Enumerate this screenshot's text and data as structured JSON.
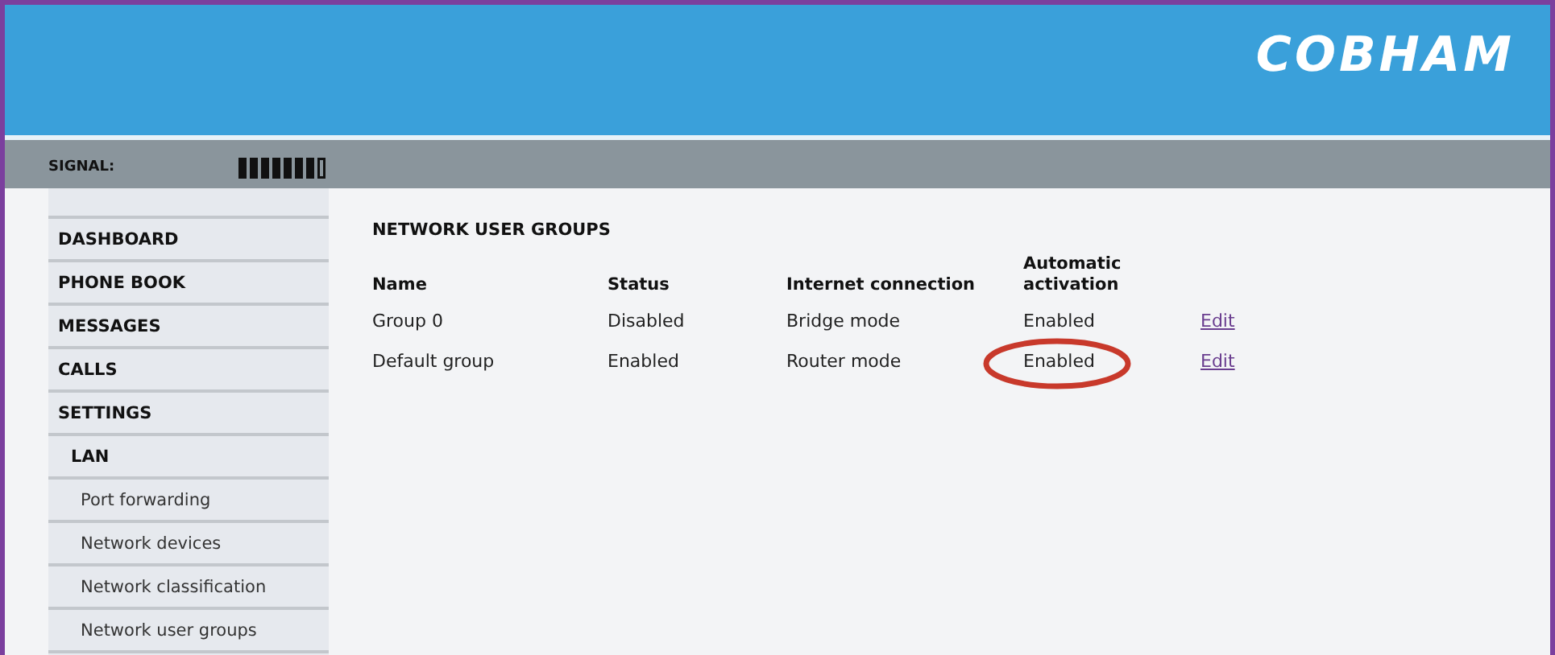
{
  "header": {
    "logo": "COBHAM"
  },
  "status_bar": {
    "label": "SIGNAL:"
  },
  "sidebar": {
    "items": [
      {
        "label": "DASHBOARD"
      },
      {
        "label": "PHONE BOOK"
      },
      {
        "label": "MESSAGES"
      },
      {
        "label": "CALLS"
      },
      {
        "label": "SETTINGS",
        "children": [
          {
            "label": "LAN",
            "children": [
              {
                "label": "Port forwarding"
              },
              {
                "label": "Network devices"
              },
              {
                "label": "Network classification"
              },
              {
                "label": "Network user groups"
              }
            ]
          }
        ]
      }
    ]
  },
  "content": {
    "title": "NETWORK USER GROUPS",
    "table": {
      "columns": [
        "Name",
        "Status",
        "Internet connection",
        "Automatic activation"
      ],
      "rows": [
        {
          "cells": [
            "Group 0",
            "Disabled",
            "Bridge mode",
            "Enabled"
          ],
          "action": "Edit",
          "circled": false
        },
        {
          "cells": [
            "Default group",
            "Enabled",
            "Router mode",
            "Enabled"
          ],
          "action": "Edit",
          "circled": true
        }
      ]
    }
  }
}
